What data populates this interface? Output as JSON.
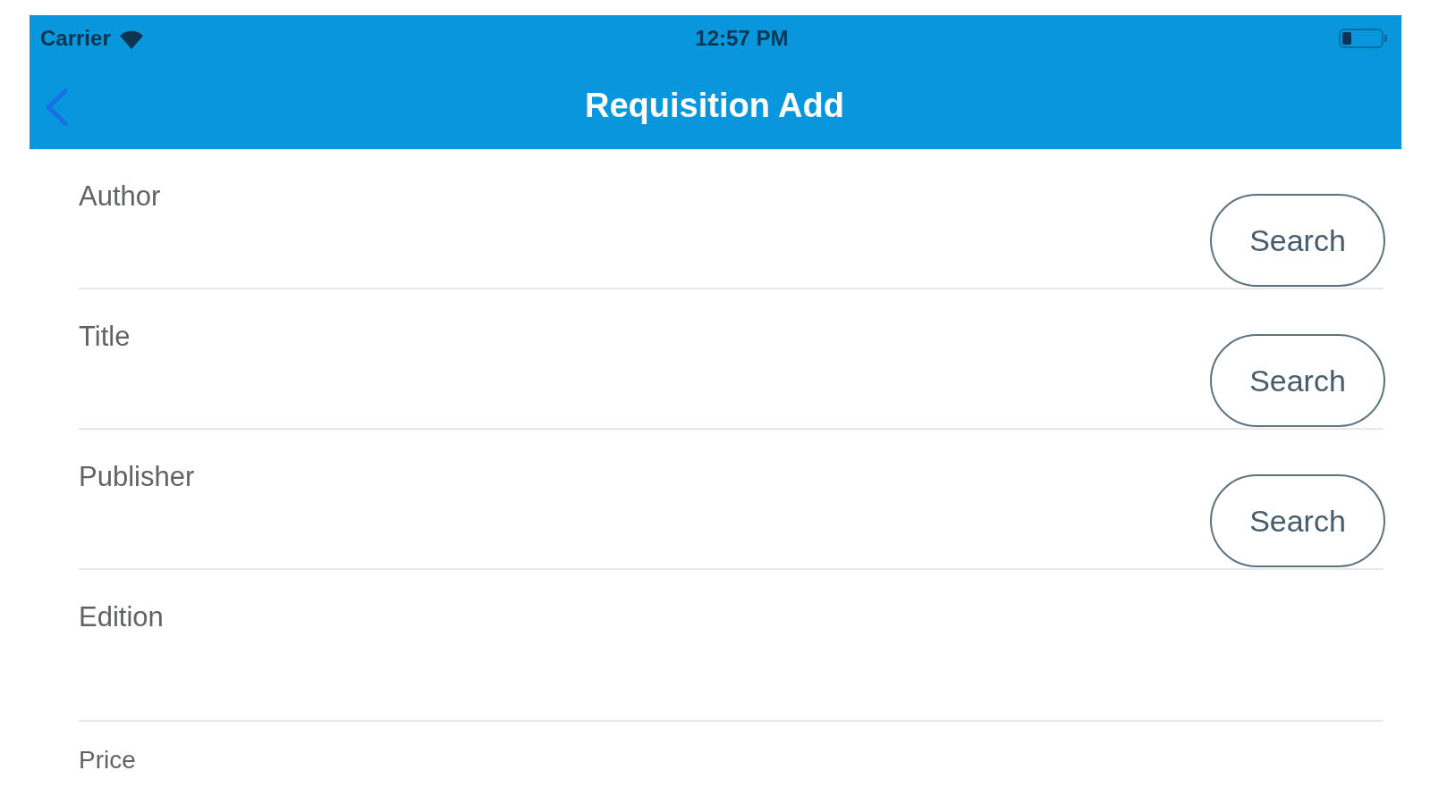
{
  "status_bar": {
    "carrier": "Carrier",
    "time": "12:57 PM"
  },
  "nav_bar": {
    "title": "Requisition Add"
  },
  "fields": [
    {
      "label": "Author",
      "button": "Search"
    },
    {
      "label": "Title",
      "button": "Search"
    },
    {
      "label": "Publisher",
      "button": "Search"
    },
    {
      "label": "Edition"
    },
    {
      "label": "Price"
    }
  ]
}
